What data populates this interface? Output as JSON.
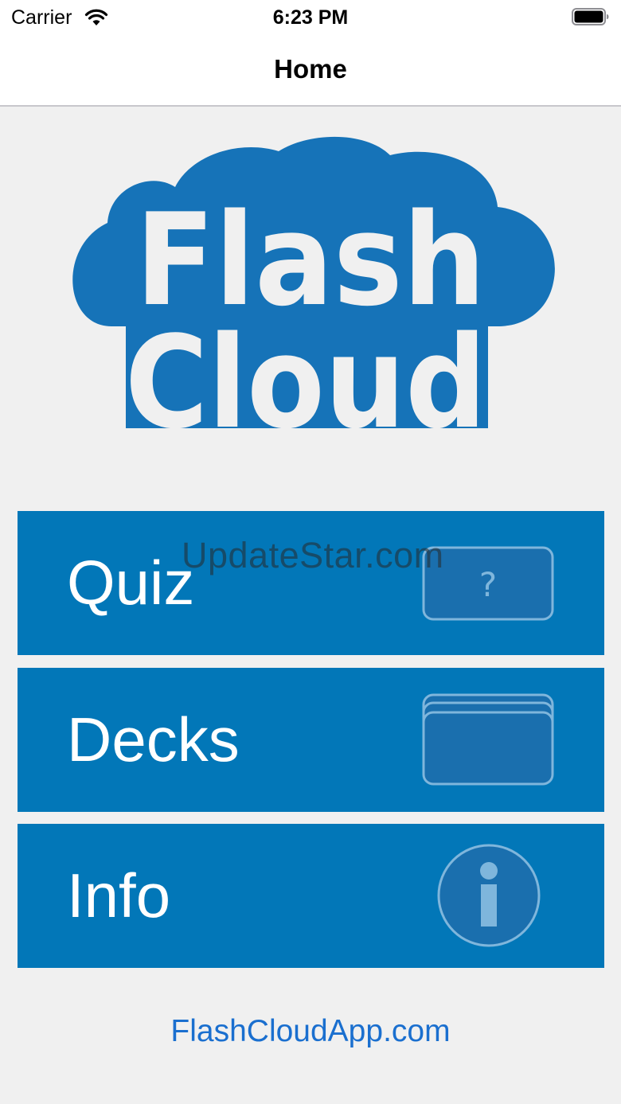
{
  "status_bar": {
    "carrier": "Carrier",
    "time": "6:23 PM"
  },
  "nav": {
    "title": "Home"
  },
  "logo": {
    "line1": "Flash",
    "line2": "Cloud",
    "brand_color": "#1673b8"
  },
  "menu": {
    "quiz": {
      "label": "Quiz",
      "icon": "question-card-icon",
      "icon_text": "?"
    },
    "decks": {
      "label": "Decks",
      "icon": "stacked-cards-icon"
    },
    "info": {
      "label": "Info",
      "icon": "info-circle-icon"
    }
  },
  "watermark": "UpdateStar.com",
  "footer": {
    "link_text": "FlashCloudApp.com"
  },
  "colors": {
    "tile": "#0277b8",
    "background": "#f0f0f0",
    "link": "#1a6fcf"
  }
}
